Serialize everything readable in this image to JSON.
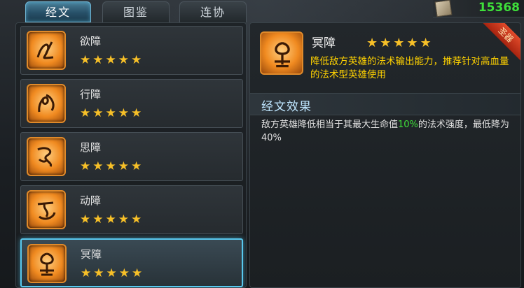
{
  "tabs": [
    {
      "label": "经文",
      "active": true
    },
    {
      "label": "图鉴",
      "active": false
    },
    {
      "label": "连协",
      "active": false
    }
  ],
  "currency": {
    "icon": "scroll-icon",
    "value": "15368",
    "color": "#3ee03a"
  },
  "list": {
    "items": [
      {
        "name": "欲障",
        "stars": "★★★★★",
        "rating": 5,
        "icon": "rune-yu-icon"
      },
      {
        "name": "行障",
        "stars": "★★★★★",
        "rating": 5,
        "icon": "rune-xing-icon"
      },
      {
        "name": "思障",
        "stars": "★★★★★",
        "rating": 5,
        "icon": "rune-si-icon"
      },
      {
        "name": "动障",
        "stars": "★★★★★",
        "rating": 5,
        "icon": "rune-dong-icon"
      },
      {
        "name": "冥障",
        "stars": "★★★★★",
        "rating": 5,
        "icon": "rune-ming-icon",
        "selected": true
      }
    ]
  },
  "detail": {
    "name": "冥障",
    "stars": "★★★★★",
    "rating": 5,
    "badge": "圣器",
    "description": "降低敌方英雄的法术输出能力，推荐针对高血量的法术型英雄使用",
    "section_title": "经文效果",
    "effect_prefix": "敌方英雄降低相当于其最大生命值",
    "effect_highlight": "10%",
    "effect_suffix": "的法术强度，最低降为40%"
  },
  "colors": {
    "accent": "#58c8ee",
    "star": "#f7c028",
    "description": "#ffd200",
    "highlight": "#3fe03a"
  }
}
